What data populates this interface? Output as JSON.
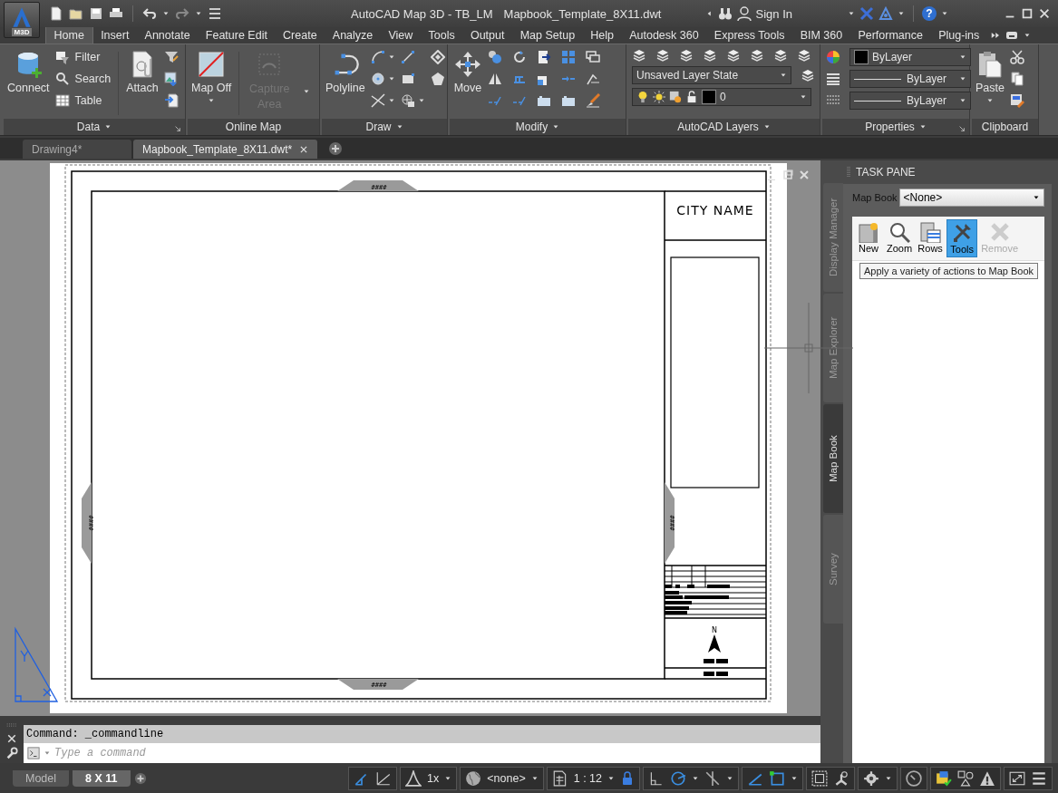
{
  "app_button": {
    "label": "M3D"
  },
  "window": {
    "title": "AutoCAD Map 3D - TB_LM",
    "file": "Mapbook_Template_8X11.dwt",
    "help": "?"
  },
  "account": {
    "sign_in": "Sign In"
  },
  "ribbon_tabs": [
    {
      "label": "Home",
      "selected": true
    },
    {
      "label": "Insert",
      "selected": false
    },
    {
      "label": "Annotate",
      "selected": false
    },
    {
      "label": "Feature Edit",
      "selected": false
    },
    {
      "label": "Create",
      "selected": false
    },
    {
      "label": "Analyze",
      "selected": false
    },
    {
      "label": "View",
      "selected": false
    },
    {
      "label": "Tools",
      "selected": false
    },
    {
      "label": "Output",
      "selected": false
    },
    {
      "label": "Map Setup",
      "selected": false
    },
    {
      "label": "Help",
      "selected": false
    },
    {
      "label": "Autodesk 360",
      "selected": false
    },
    {
      "label": "Express Tools",
      "selected": false
    },
    {
      "label": "BIM 360",
      "selected": false
    },
    {
      "label": "Performance",
      "selected": false
    },
    {
      "label": "Plug-ins",
      "selected": false
    }
  ],
  "ribbon": {
    "data": {
      "title": "Data",
      "connect": "Connect",
      "filter": "Filter",
      "search": "Search",
      "table": "Table",
      "attach": "Attach"
    },
    "online_map": {
      "title": "Online Map",
      "map_off": "Map Off",
      "capture_area": {
        "label": "Capture Area",
        "disabled": true
      }
    },
    "draw": {
      "title": "Draw",
      "polyline": "Polyline"
    },
    "modify": {
      "title": "Modify",
      "move": "Move"
    },
    "layers": {
      "title": "AutoCAD Layers",
      "layer_state": "Unsaved Layer State",
      "layer": "0"
    },
    "properties": {
      "title": "Properties",
      "color_setting": "ByLayer",
      "lineweight": "ByLayer",
      "linetype": "ByLayer"
    },
    "clipboard": {
      "title": "Clipboard",
      "paste": "Paste"
    }
  },
  "doc_tabs": [
    {
      "label": "Drawing4*",
      "selected": false
    },
    {
      "label": "Mapbook_Template_8X11.dwt*",
      "selected": true
    }
  ],
  "drawing": {
    "city_name": "CITY NAME",
    "grip_labels": [
      "####",
      "####",
      "####",
      "####"
    ],
    "north": "N"
  },
  "side_tabs": [
    {
      "label": "Display Manager",
      "selected": false
    },
    {
      "label": "Map Explorer",
      "selected": false
    },
    {
      "label": "Map Book",
      "selected": true
    },
    {
      "label": "Survey",
      "selected": false
    }
  ],
  "task_pane": {
    "title": "TASK PANE",
    "map_book_label": "Map Book",
    "map_book_value": "<None>",
    "tools": [
      {
        "label": "New",
        "selected": false,
        "disabled": false
      },
      {
        "label": "Zoom",
        "selected": false,
        "disabled": false
      },
      {
        "label": "Rows",
        "selected": false,
        "disabled": false
      },
      {
        "label": "Tools",
        "selected": true,
        "disabled": false
      },
      {
        "label": "Remove",
        "selected": false,
        "disabled": true
      }
    ],
    "tooltip": "Apply a variety of actions to Map Book"
  },
  "command": {
    "history": "Command: _commandline",
    "placeholder": "Type a command"
  },
  "layout_tabs": [
    {
      "label": "Model",
      "selected": false
    },
    {
      "label": "8 X 11",
      "selected": true
    }
  ],
  "status_bar": {
    "scale": "1x",
    "coordinate": "<none>",
    "annotation_scale": "1 : 12"
  }
}
